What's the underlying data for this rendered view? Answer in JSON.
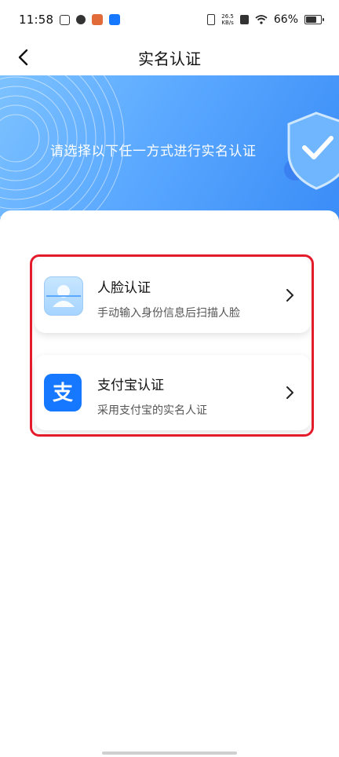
{
  "status_bar": {
    "time": "11:58",
    "net_speed_value": "26.5",
    "net_speed_unit": "KB/s",
    "battery_percent": "66%",
    "battery_level": 0.66
  },
  "header": {
    "title": "实名认证",
    "back_icon": "chevron-left-icon"
  },
  "banner": {
    "text": "请选择以下任一方式进行实名认证",
    "icon": "shield-check-icon"
  },
  "options": [
    {
      "title": "人脸认证",
      "description": "手动输入身份信息后扫描人脸",
      "icon": "face-scan-icon"
    },
    {
      "title": "支付宝认证",
      "description": "采用支付宝的实名人证",
      "icon": "alipay-icon"
    }
  ],
  "colors": {
    "banner": "#5aa8ff",
    "highlight": "#e41b2b",
    "alipay": "#1677ff"
  }
}
